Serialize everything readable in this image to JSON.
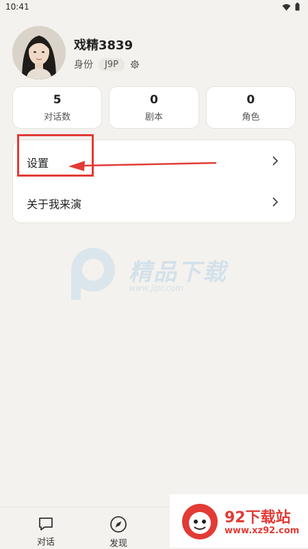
{
  "status_bar": {
    "time": "10:41"
  },
  "profile": {
    "name": "戏精3839",
    "identity_label": "身份",
    "identity_badge": "J9P"
  },
  "stats": [
    {
      "value": "5",
      "label": "对话数"
    },
    {
      "value": "0",
      "label": "剧本"
    },
    {
      "value": "0",
      "label": "角色"
    }
  ],
  "menu": [
    {
      "label": "设置"
    },
    {
      "label": "关于我来演"
    }
  ],
  "watermark": {
    "text": "精品下载",
    "url": "www.jlpr.com"
  },
  "bottom_nav": [
    {
      "label": "对话",
      "icon": "chat-bubble-icon"
    },
    {
      "label": "发现",
      "icon": "compass-icon"
    }
  ],
  "ad": {
    "title": "92下载站",
    "url": "www.xz92.com"
  },
  "colors": {
    "background": "#f4f2ee",
    "card": "#ffffff",
    "highlight": "#e23b35",
    "text": "#222222"
  }
}
